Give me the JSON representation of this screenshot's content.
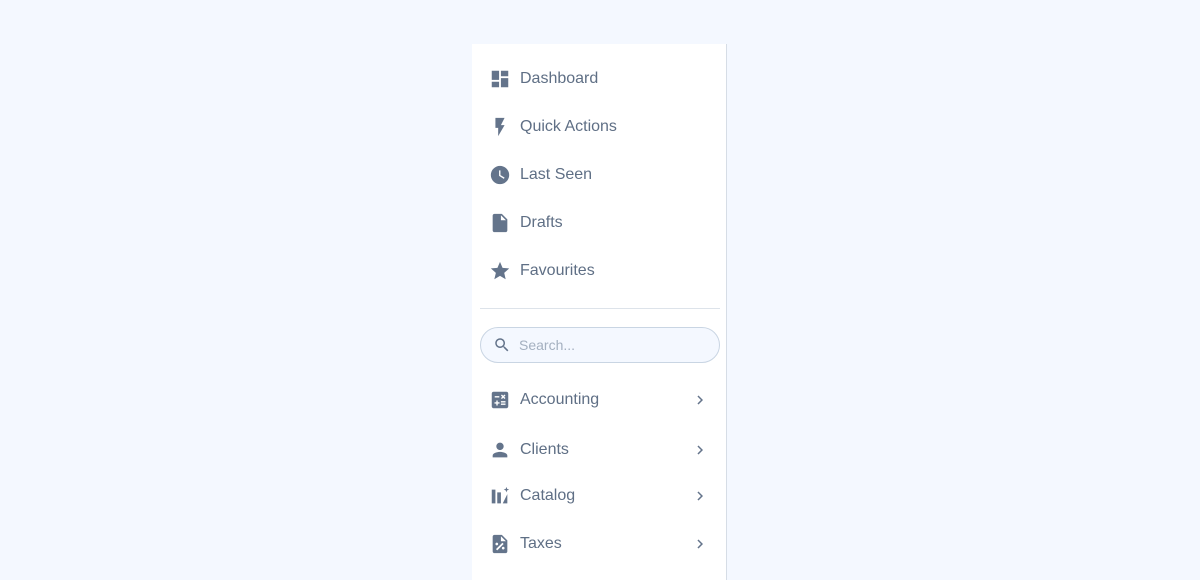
{
  "nav": {
    "top_items": [
      {
        "label": "Dashboard",
        "icon": "dashboard-icon"
      },
      {
        "label": "Quick Actions",
        "icon": "bolt-icon"
      },
      {
        "label": "Last Seen",
        "icon": "clock-icon"
      },
      {
        "label": "Drafts",
        "icon": "document-icon"
      },
      {
        "label": "Favourites",
        "icon": "star-icon"
      }
    ],
    "search": {
      "placeholder": "Search...",
      "value": "",
      "icon": "search-icon"
    },
    "section_items": [
      {
        "label": "Accounting",
        "icon": "calculator-icon",
        "chevron": "chevron-right-icon"
      },
      {
        "label": "Clients",
        "icon": "person-icon",
        "chevron": "chevron-right-icon"
      },
      {
        "label": "Catalog",
        "icon": "catalog-icon",
        "chevron": "chevron-right-icon"
      },
      {
        "label": "Taxes",
        "icon": "tax-document-icon",
        "chevron": "chevron-right-icon"
      }
    ]
  },
  "colors": {
    "background": "#f4f8ff",
    "panel": "#ffffff",
    "icon": "#64748b",
    "text": "#5f6f85",
    "border": "#d6dde6"
  }
}
